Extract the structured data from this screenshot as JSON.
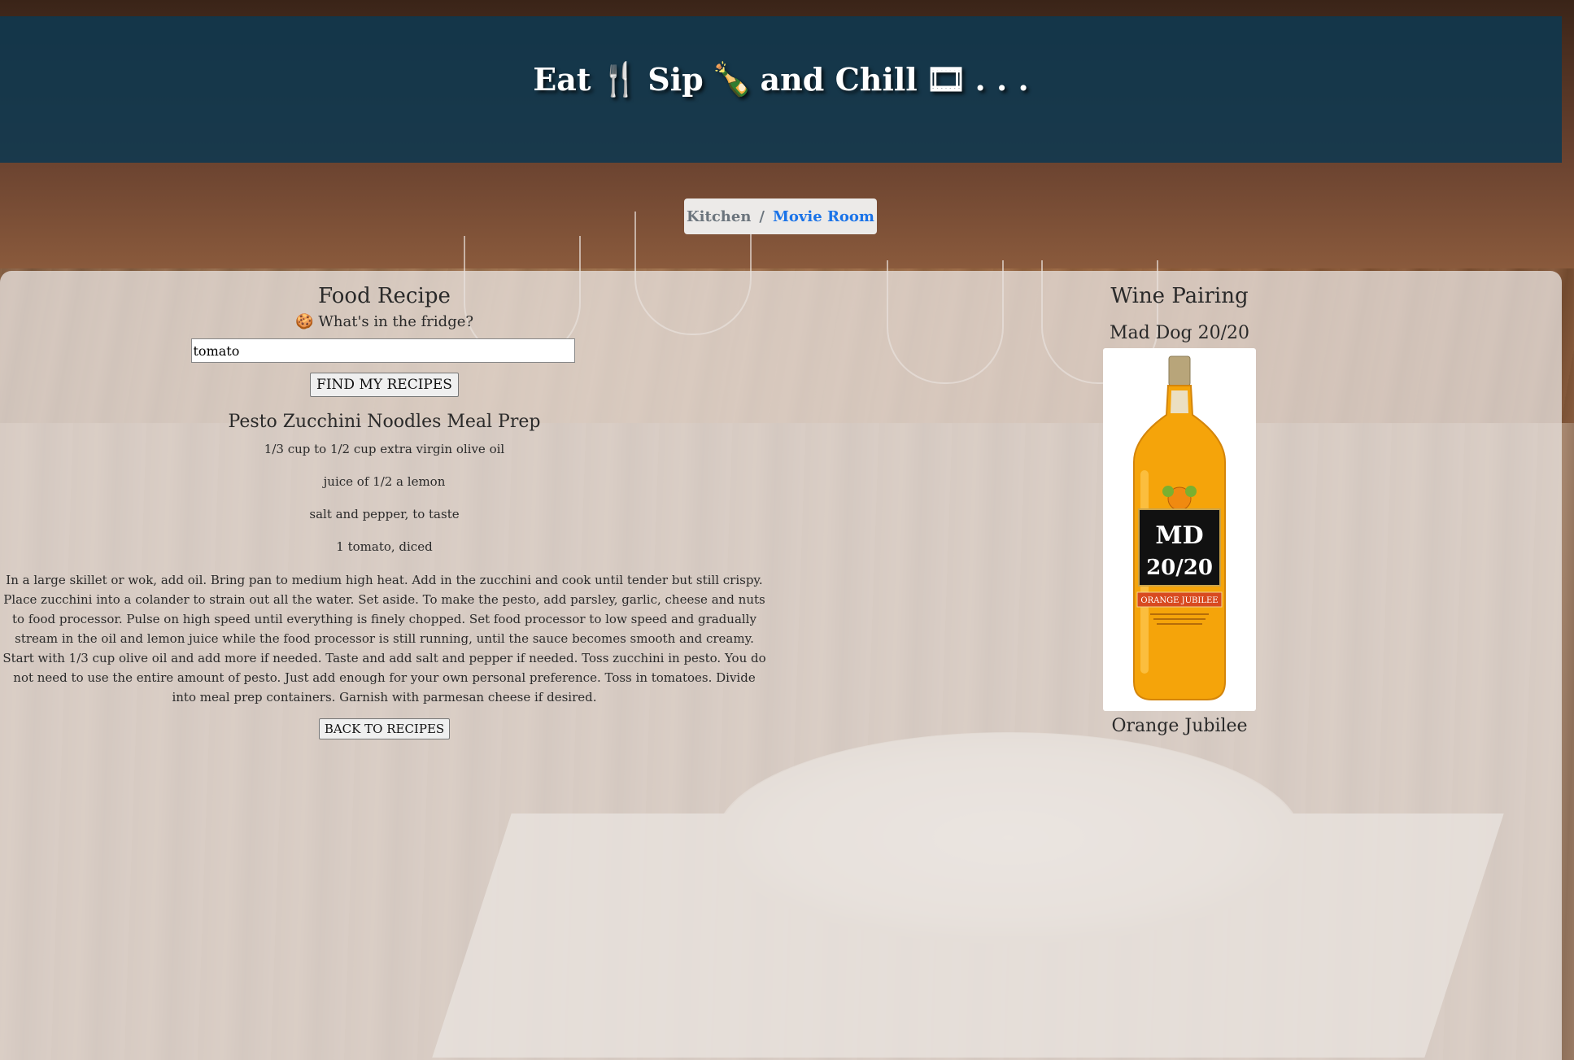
{
  "header": {
    "eat": "Eat",
    "eat_icon": "🍴",
    "sip": "Sip",
    "sip_icon": "🍾",
    "and_chill": "and Chill",
    "chill_icon": "🎞",
    "ellipsis": ". . ."
  },
  "breadcrumb": {
    "items": [
      "Kitchen",
      "Movie Room"
    ],
    "separator": "/"
  },
  "food": {
    "title": "Food Recipe",
    "prompt_icon": "🍪",
    "prompt": "What's in the fridge?",
    "search_value": "tomato",
    "find_button": "FIND MY RECIPES",
    "recipe_title": "Pesto Zucchini Noodles Meal Prep",
    "ingredients": [
      "1/3 cup to 1/2 cup extra virgin olive oil",
      "juice of 1/2 a lemon",
      "salt and pepper, to taste",
      "1 tomato, diced"
    ],
    "instructions": "In a large skillet or wok, add oil. Bring pan to medium high heat. Add in the zucchini and cook until tender but still crispy. Place zucchini into a colander to strain out all the water. Set aside. To make the pesto, add parsley, garlic, cheese and nuts to food processor. Pulse on high speed until everything is finely chopped. Set food processor to low speed and gradually stream in the oil and lemon juice while the food processor is still running, until the sauce becomes smooth and creamy. Start with 1/3 cup olive oil and add more if needed. Taste and add salt and pepper if needed. Toss zucchini in pesto. You do not need to use the entire amount of pesto. Just add enough for your own personal preference. Toss in tomatoes. Divide into meal prep containers. Garnish with parmesan cheese if desired.",
    "back_button": "BACK TO RECIPES"
  },
  "wine": {
    "title": "Wine Pairing",
    "name": "Mad Dog 20/20",
    "label_brand_line1": "MD",
    "label_brand_line2": "20/20",
    "label_flavor": "ORANGE JUBILEE",
    "flavor": "Orange Jubilee"
  },
  "colors": {
    "header_bg": "#0e3850",
    "link": "#1a73e8",
    "bottle": "#f5a40a"
  }
}
